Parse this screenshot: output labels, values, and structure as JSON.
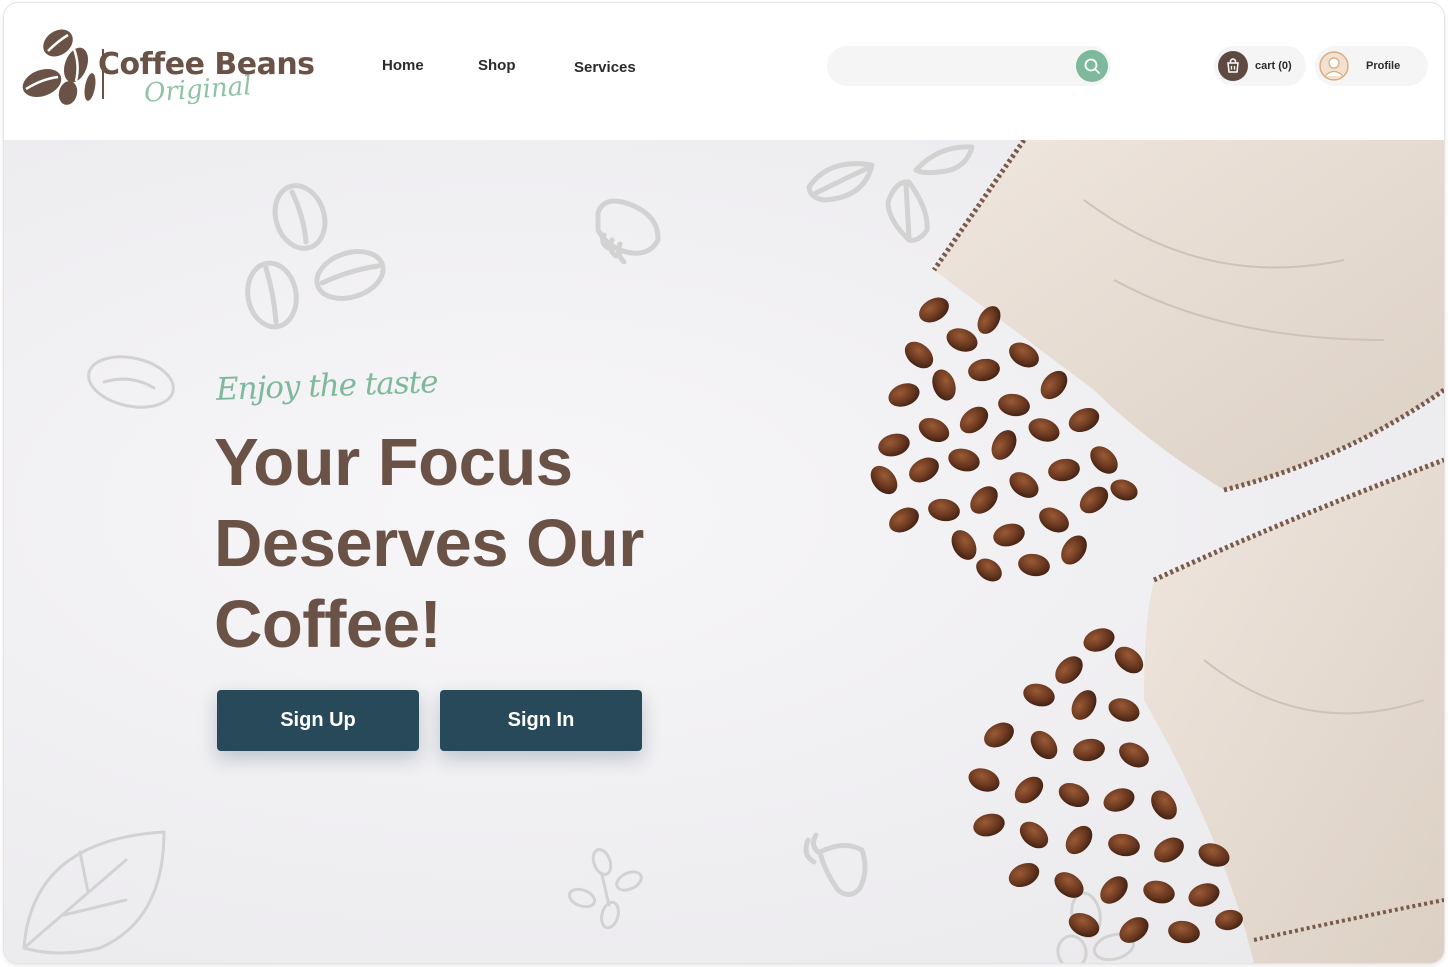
{
  "brand": {
    "name": "Coffee Beans",
    "tagline": "Original",
    "icon": "coffee-beans-logo-icon",
    "colors": {
      "primary": "#6b5247",
      "accent": "#7db99a",
      "button": "#27495a"
    }
  },
  "nav": {
    "items": [
      {
        "label": "Home"
      },
      {
        "label": "Shop"
      },
      {
        "label": "Services"
      }
    ]
  },
  "search": {
    "placeholder": "",
    "value": "",
    "icon": "search-icon"
  },
  "cart": {
    "label": "cart (0)",
    "icon": "cart-icon"
  },
  "profile": {
    "label": "Profile",
    "icon": "user-avatar-icon"
  },
  "hero": {
    "eyebrow": "Enjoy the taste",
    "headline": "Your Focus Deserves Our Coffee!",
    "signup_label": "Sign Up",
    "signin_label": "Sign In",
    "image": "coffee-beans-spilling-from-linen-bags"
  }
}
